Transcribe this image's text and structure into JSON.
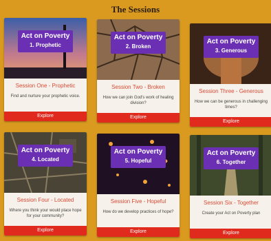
{
  "page_title": "The Sessions",
  "badge_brand": "Act on Poverty",
  "sessions": [
    {
      "badge_sub": "1. Prophetic",
      "title": "Session One - Prophetic",
      "desc": "Find and nurture your prophetic voice.",
      "button": "Explore"
    },
    {
      "badge_sub": "2. Broken",
      "title": "Session Two - Broken",
      "desc": "How we can join God's work of healing division?",
      "button": "Explore"
    },
    {
      "badge_sub": "3. Generous",
      "title": "Session Three - Generous",
      "desc": "How we can be generous in challenging times?",
      "button": "Explore"
    },
    {
      "badge_sub": "4. Located",
      "title": "Session Four - Located",
      "desc": "Where you think your would place hope for your community?",
      "button": "Explore"
    },
    {
      "badge_sub": "5. Hopeful",
      "title": "Session Five - Hopeful",
      "desc": "How do we develop practices of hope?",
      "button": "Explore"
    },
    {
      "badge_sub": "6. Together",
      "title": "Session Six - Together",
      "desc": "Create your Act on Poverty plan",
      "button": "Explore"
    }
  ]
}
